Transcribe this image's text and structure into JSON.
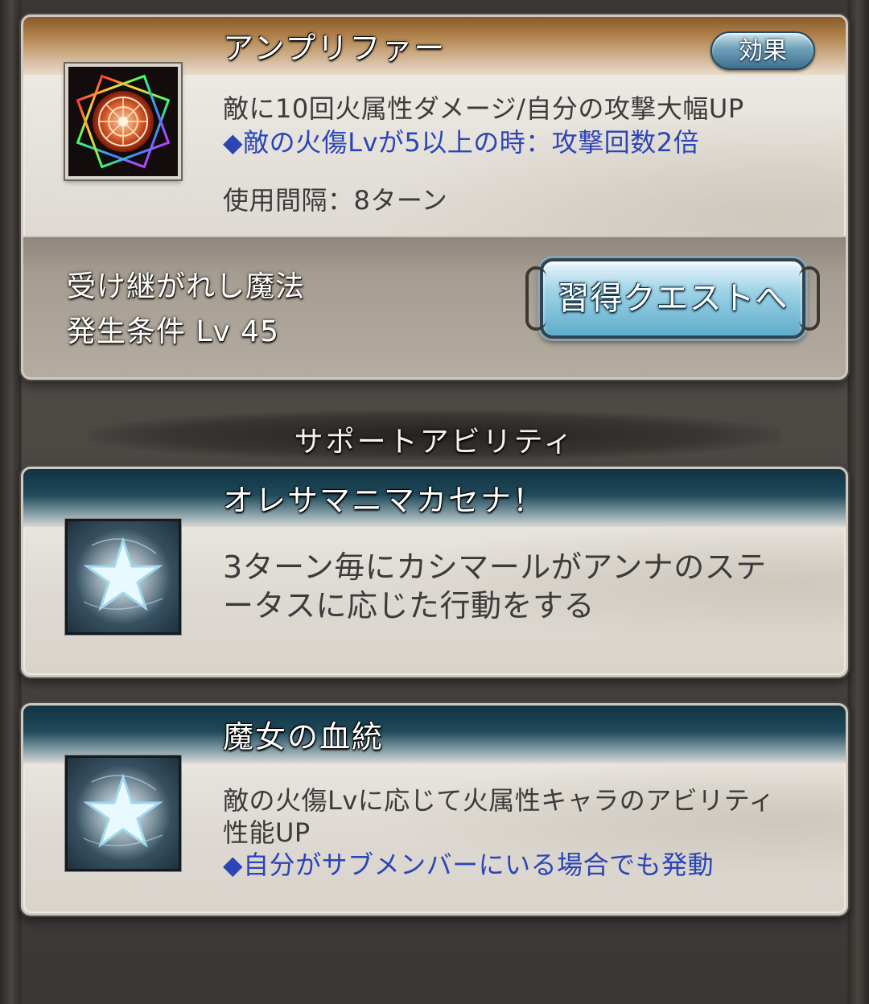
{
  "skill_card": {
    "title": "アンプリファー",
    "effect_button": "効果",
    "description": "敵に10回火属性ダメージ/自分の攻撃大幅UP",
    "note": "◆敵の火傷Lvが5以上の時：攻撃回数2倍",
    "cooldown": "使用間隔：8ターン",
    "inherited_label": "受け継がれし魔法",
    "condition": "発生条件 Lv 45",
    "quest_button": "習得クエストへ",
    "icon": "fire-magic-circle-icon"
  },
  "section": {
    "title": "サポートアビリティ"
  },
  "support_abilities": [
    {
      "title": "オレサマニマカセナ！",
      "description_line1": "3ターン毎にカシマールがアンナのステ",
      "description_line2": "ータスに応じた行動をする",
      "icon": "star-icon"
    },
    {
      "title": "魔女の血統",
      "description_line1": "敵の火傷Lvに応じて火属性キャラのアビリティ",
      "description_line2": "性能UP",
      "note": "◆自分がサブメンバーにいる場合でも発動",
      "icon": "star-icon"
    }
  ],
  "colors": {
    "note_blue": "#2b45b5",
    "header_brown": "#8a5a2c",
    "header_teal": "#123341",
    "button_blue": "#5eaccb"
  }
}
